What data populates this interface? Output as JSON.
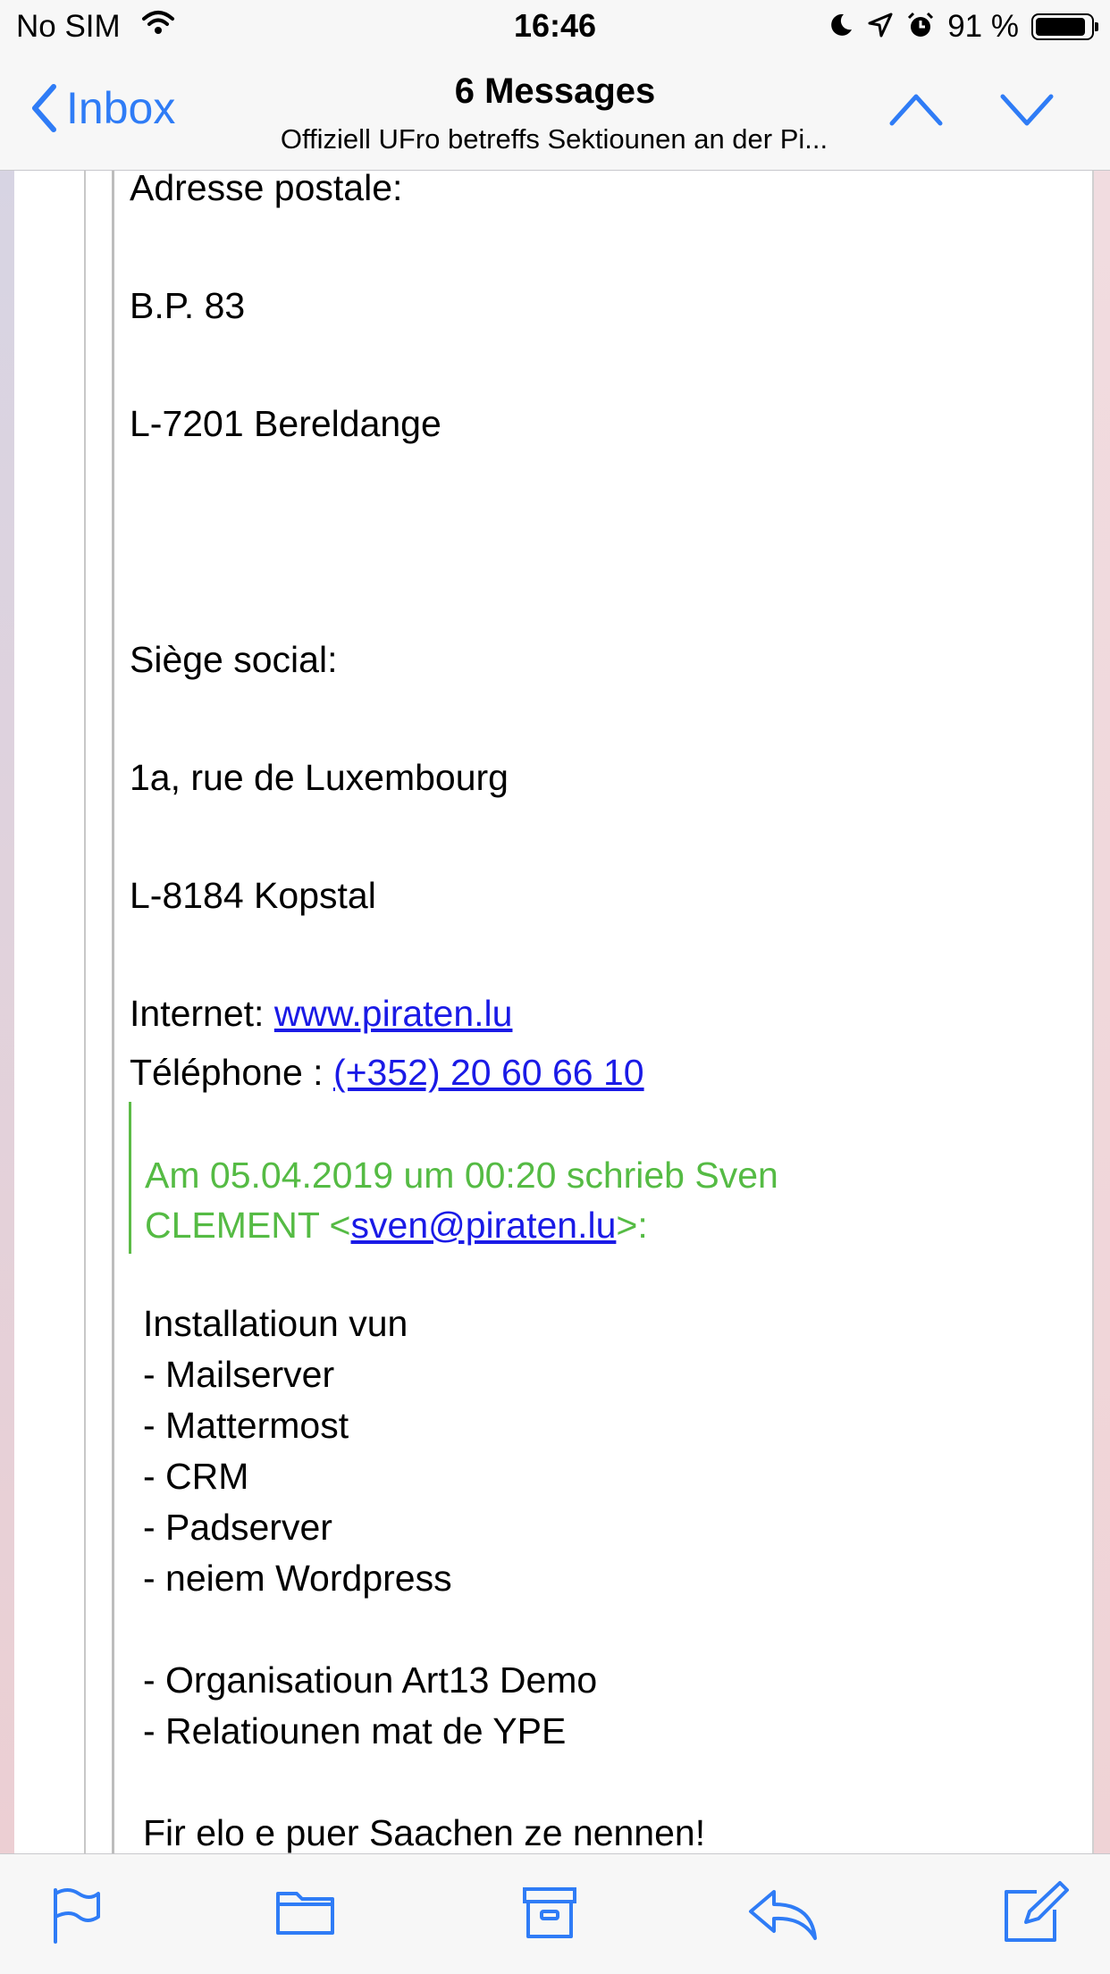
{
  "status_bar": {
    "carrier": "No SIM",
    "time": "16:46",
    "battery_percent": "91 %",
    "battery_level": 0.91
  },
  "nav": {
    "back_label": "Inbox",
    "title": "6 Messages",
    "subtitle": "Offiziell UFro betreffs Sektiounen an der Pi..."
  },
  "email": {
    "postal_label": "Adresse postale:",
    "po_box": "B.P. 83",
    "postal_city": "L-7201 Bereldange",
    "seat_label": "Siège social:",
    "seat_street": "1a, rue de Luxembourg",
    "seat_city": "L-8184 Kopstal",
    "internet_label": "Internet: ",
    "internet_link": "www.piraten.lu",
    "phone_label": "Téléphone : ",
    "phone_link": "(+352) 20 60 66 10",
    "quote_header_line1": "Am 05.04.2019 um 00:20 schrieb Sven",
    "quote_header_line2_prefix": "CLEMENT <",
    "quote_email": "sven@piraten.lu",
    "quote_header_line2_suffix": ">:",
    "body_intro": "Installatioun vun",
    "items": [
      "- Mailserver",
      "- Mattermost",
      "- CRM",
      "- Padserver",
      "- neiem Wordpress"
    ],
    "items2": [
      "- Organisatioun Art13 Demo",
      "- Relatiounen mat de YPE"
    ],
    "closing": "Fir elo e puer Saachen ze nennen!"
  },
  "colors": {
    "accent": "#2f7cf6",
    "link": "#1a1ae6",
    "quote": "#55bb44"
  },
  "toolbar_icons": [
    "flag-icon",
    "folder-icon",
    "archive-icon",
    "reply-icon",
    "compose-icon"
  ]
}
